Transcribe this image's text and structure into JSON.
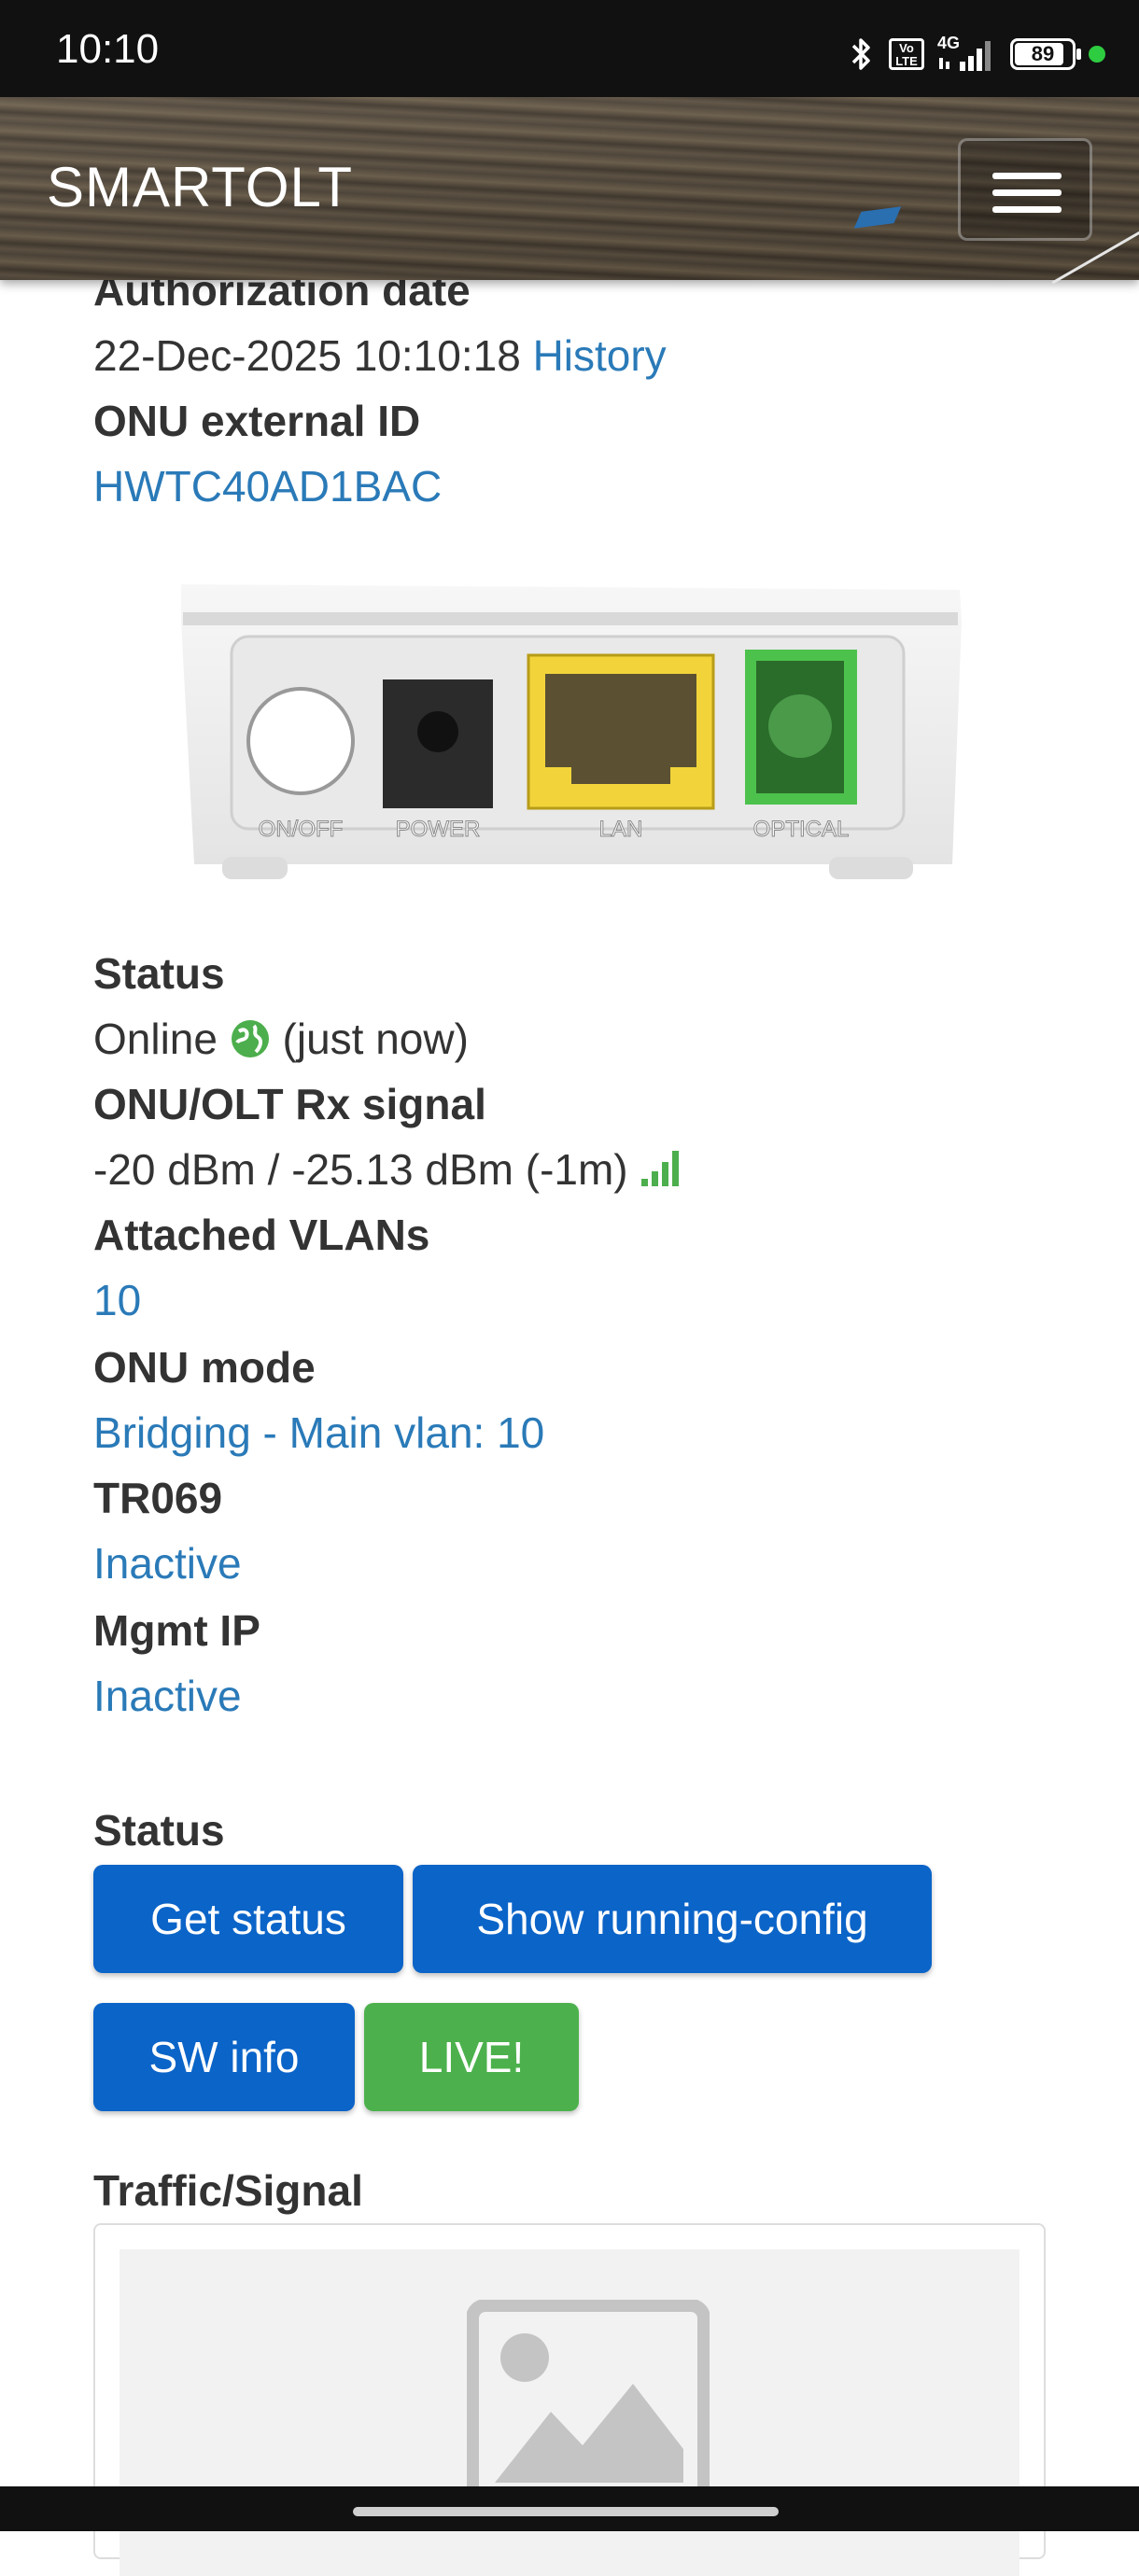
{
  "status_bar": {
    "time": "10:10",
    "volte": "Vo LTE",
    "network": "4G",
    "battery": "89"
  },
  "header": {
    "brand": "SMARTOLT"
  },
  "details": {
    "authorization_label": "Authorization date",
    "authorization_value": "22-Dec-2025 10:10:18",
    "history_link": "History",
    "external_id_label": "ONU external ID",
    "external_id_value": "HWTC40AD1BAC"
  },
  "device": {
    "ports": [
      "ON/OFF",
      "POWER",
      "LAN",
      "OPTICAL"
    ]
  },
  "status_info": {
    "status_label": "Status",
    "online_text": "Online",
    "online_time": "(just now)",
    "rx_label": "ONU/OLT Rx signal",
    "rx_value": "-20 dBm / -25.13 dBm (-1m)",
    "vlans_label": "Attached VLANs",
    "vlans_value": "10",
    "mode_label": "ONU mode",
    "mode_value": "Bridging - Main vlan: 10",
    "tr069_label": "TR069",
    "tr069_value": "Inactive",
    "mgmt_label": "Mgmt IP",
    "mgmt_value": "Inactive"
  },
  "actions": {
    "section_label": "Status",
    "get_status": "Get status",
    "show_running_config": "Show running-config",
    "sw_info": "SW info",
    "live": "LIVE!"
  },
  "traffic": {
    "label": "Traffic/Signal"
  },
  "colors": {
    "link": "#2a7ab8",
    "primary_button": "#0b64c8",
    "success_button": "#4cb14c",
    "online_icon": "#4cae4c"
  },
  "icons": [
    "bluetooth-icon",
    "signal-icon",
    "battery-icon",
    "menu-icon",
    "globe-icon",
    "signal-bars-icon",
    "image-placeholder-icon"
  ]
}
